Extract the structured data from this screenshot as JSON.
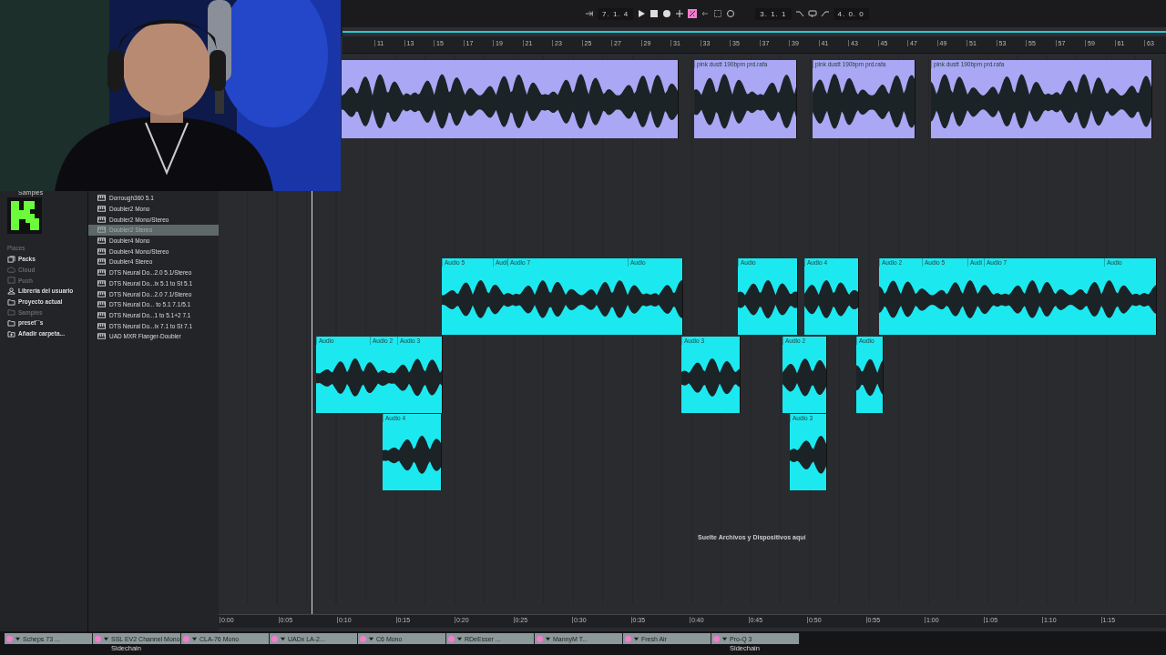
{
  "transport": {
    "position": "7. 1. 4",
    "automation_arm": true,
    "loop_start": "3. 1. 1",
    "loop_length": "4. 0. 0"
  },
  "ruler_bars": [
    "11",
    "13",
    "15",
    "17",
    "19",
    "21",
    "23",
    "25",
    "27",
    "29",
    "31",
    "33",
    "35",
    "37",
    "39",
    "41",
    "43",
    "45",
    "47",
    "49",
    "51",
    "53",
    "55",
    "57",
    "59",
    "61",
    "63"
  ],
  "tracks": [
    {
      "color": "#aaa7f4",
      "clips": [
        {
          "kind": "audio"
        },
        {
          "segments": [
            "pink dustt 190bpm prd.rafa"
          ]
        },
        {
          "segments": [
            "pink dustt 190bpm prd.rafa"
          ]
        },
        {
          "segments": [
            "pink dustt 190bpm prd.rafa"
          ]
        }
      ]
    },
    {
      "color": "#1ce9ef",
      "clips": [
        {
          "segments": [
            "Audio 5",
            "Audi",
            "Audio 7",
            "Audio"
          ]
        },
        {
          "segments": [
            "Audio"
          ]
        },
        {
          "segments": [
            "Audio 4"
          ]
        },
        {
          "segments": [
            "Audio 2",
            "Audio 5",
            "Audi",
            "Audio 7",
            "Audio"
          ]
        }
      ]
    },
    {
      "color": "#1ce9ef",
      "clips": [
        {
          "segments": [
            "Audio",
            "Audio 2",
            "Audio 3"
          ]
        },
        {
          "segments": [
            "Audio 3"
          ]
        },
        {
          "segments": [
            "Audio 2"
          ]
        },
        {
          "segments": [
            "Audio"
          ]
        }
      ]
    },
    {
      "color": "#1ce9ef",
      "clips": [
        {
          "segments": [
            "Audio 4"
          ]
        },
        {
          "segments": [
            "Audio 3"
          ]
        }
      ]
    }
  ],
  "drop_hint": "Suelte Archivos y Dispositivos aquí",
  "time_ruler": [
    "0:00",
    "0:05",
    "0:10",
    "0:15",
    "0:20",
    "0:25",
    "0:30",
    "0:35",
    "0:40",
    "0:45",
    "0:50",
    "0:55",
    "1:00",
    "1:05",
    "1:10",
    "1:15"
  ],
  "browser": {
    "header": "Samples",
    "places_title": "Places",
    "places": [
      {
        "kind": "packs",
        "label": "Packs",
        "disabled": false
      },
      {
        "kind": "cloud",
        "label": "Cloud",
        "disabled": true
      },
      {
        "kind": "push",
        "label": "Push",
        "disabled": true
      },
      {
        "kind": "user",
        "label": "Librería del usuario",
        "disabled": false
      },
      {
        "kind": "project",
        "label": "Proyecto actual",
        "disabled": false
      },
      {
        "kind": "folder",
        "label": "Samples",
        "disabled": true
      },
      {
        "kind": "folder",
        "label": "preset``s",
        "disabled": false
      },
      {
        "kind": "add",
        "label": "Añadir carpeta...",
        "disabled": false
      }
    ],
    "items": [
      {
        "label": "Dorrough360 5.1",
        "selected": false
      },
      {
        "label": "Doubler2 Mono",
        "selected": false
      },
      {
        "label": "Doubler2 Mono/Stereo",
        "selected": false
      },
      {
        "label": "Doubler2 Stereo",
        "selected": true
      },
      {
        "label": "Doubler4 Mono",
        "selected": false
      },
      {
        "label": "Doubler4 Mono/Stereo",
        "selected": false
      },
      {
        "label": "Doubler4 Stereo",
        "selected": false
      },
      {
        "label": "DTS Neural Do...2.0 5.1/Stereo",
        "selected": false
      },
      {
        "label": "DTS Neural Do...ix 5.1 to St 5.1",
        "selected": false
      },
      {
        "label": "DTS Neural Do...2.0 7.1/Stereo",
        "selected": false
      },
      {
        "label": "DTS Neural Do... to 5.1 7.1/5.1",
        "selected": false
      },
      {
        "label": "DTS Neural Do...1 to 5.1+2 7.1",
        "selected": false
      },
      {
        "label": "DTS Neural Do...ix 7.1 to St 7.1",
        "selected": false
      },
      {
        "label": "UAD MXR Flanger-Doubler",
        "selected": false
      }
    ]
  },
  "devices": [
    {
      "name": "Scheps 73 ...",
      "on": true
    },
    {
      "name": "SSL EV2 Channel Mono",
      "on": true,
      "sidechain": "Sidechain"
    },
    {
      "name": "CLA-76 Mono",
      "on": true
    },
    {
      "name": "UADx LA-2...",
      "on": true
    },
    {
      "name": "C6 Mono",
      "on": true
    },
    {
      "name": "RDeEsser ...",
      "on": true
    },
    {
      "name": "MannyM T...",
      "on": true
    },
    {
      "name": "Fresh Air",
      "on": true
    },
    {
      "name": "Pro-Q 3",
      "on": true,
      "sidechain": "Sidechain"
    }
  ]
}
